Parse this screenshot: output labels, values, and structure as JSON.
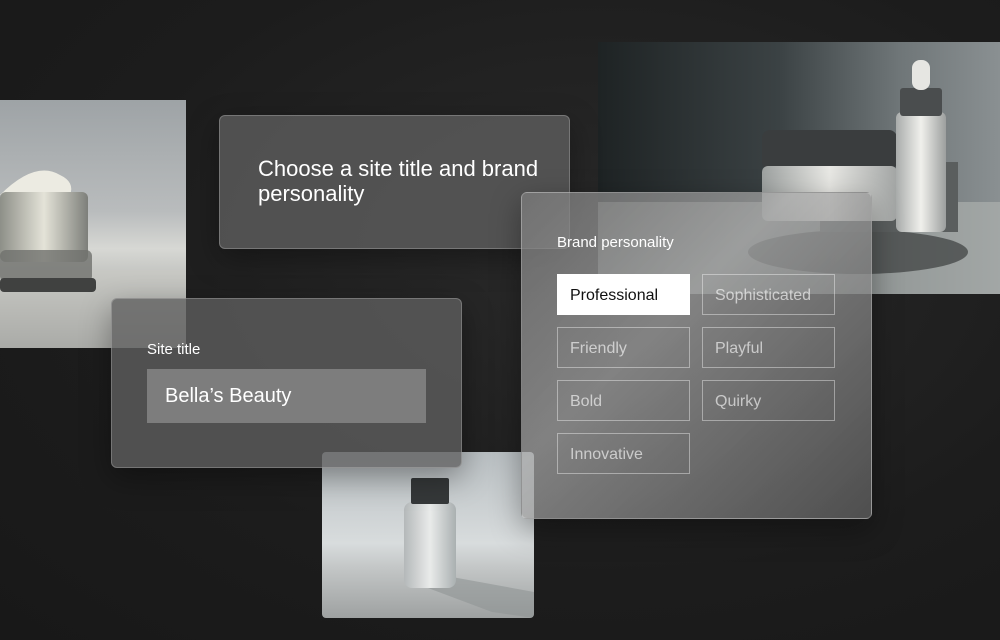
{
  "headline": "Choose a site title and brand personality",
  "site_title": {
    "label": "Site title",
    "value": "Bella’s Beauty"
  },
  "brand_personality": {
    "label": "Brand personality",
    "selected": "Professional",
    "options": [
      "Professional",
      "Sophisticated",
      "Friendly",
      "Playful",
      "Bold",
      "Quirky",
      "Innovative"
    ]
  },
  "colors": {
    "background": "#1c1c1c",
    "panel": "#5f5f5f",
    "selected_chip": "#ffffff"
  }
}
